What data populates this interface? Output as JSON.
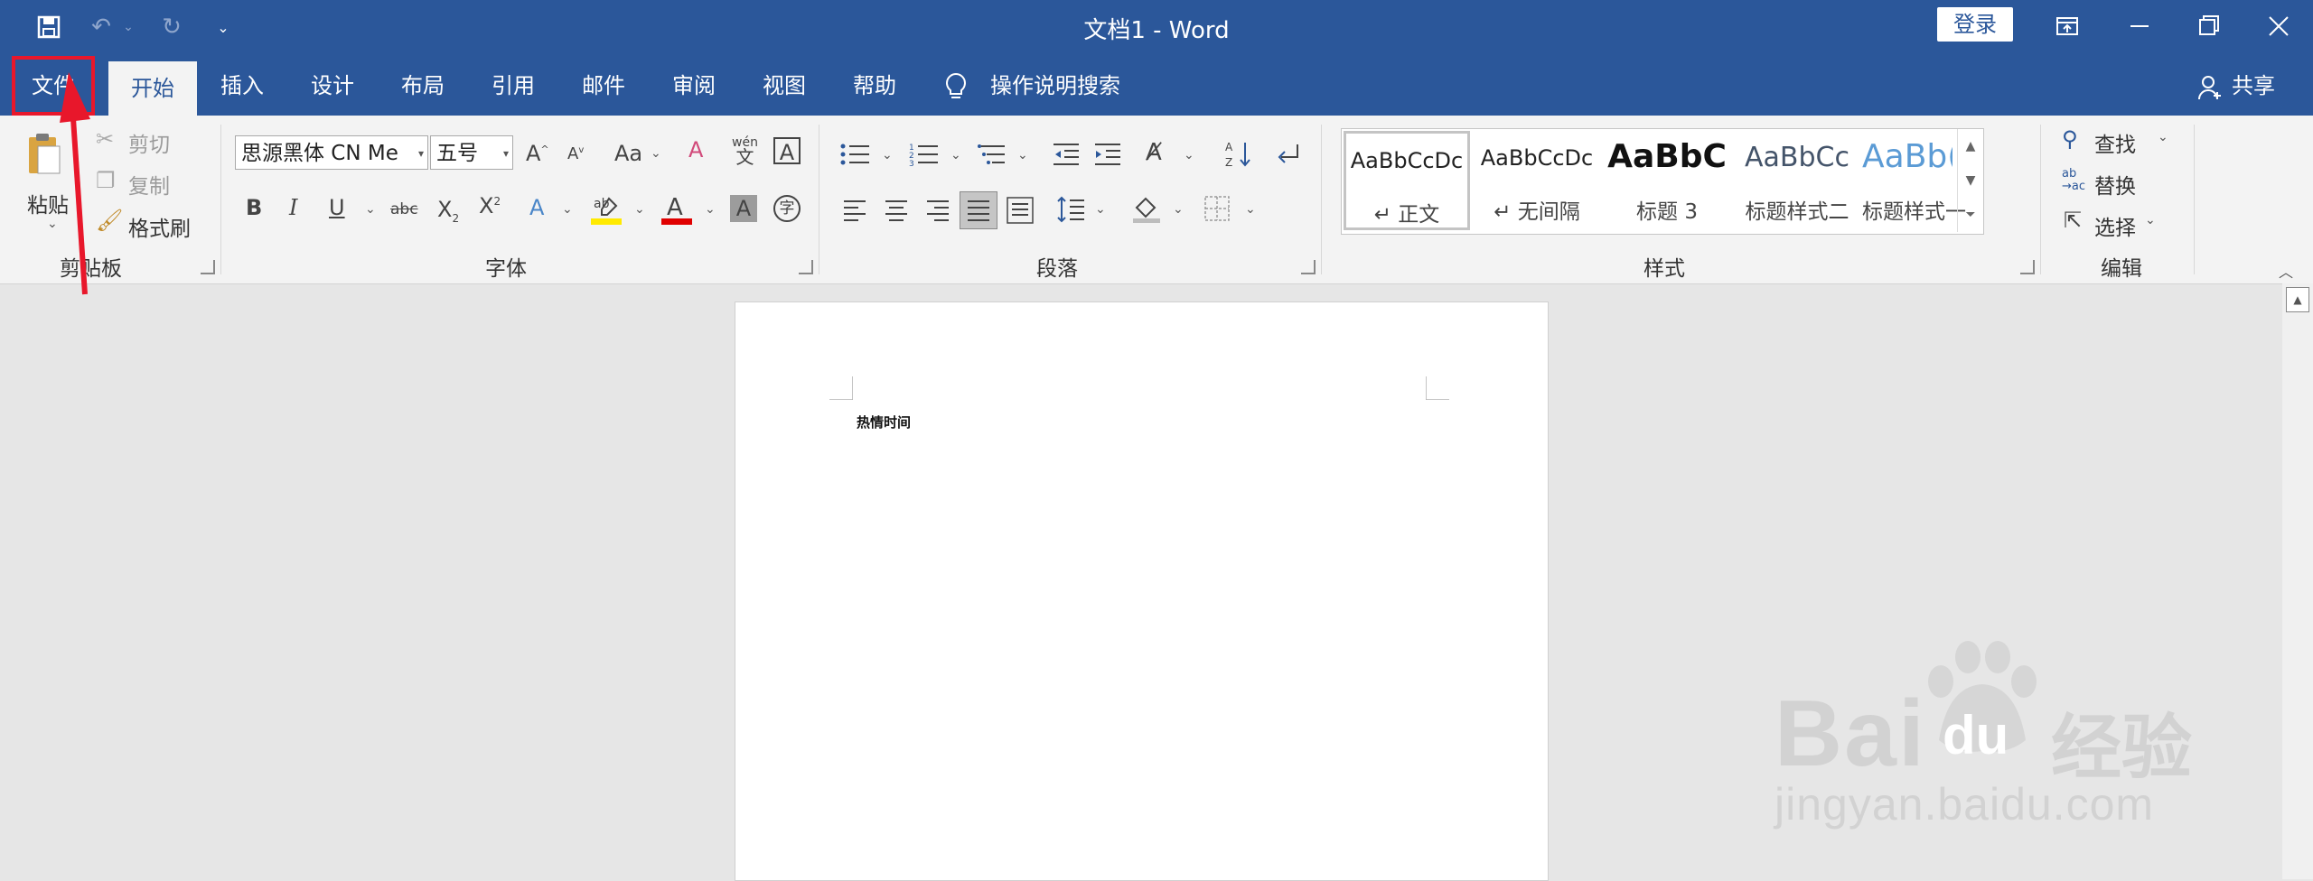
{
  "window": {
    "title": "文档1  -  Word",
    "login_label": "登录"
  },
  "tabs": [
    {
      "label": "文件"
    },
    {
      "label": "开始"
    },
    {
      "label": "插入"
    },
    {
      "label": "设计"
    },
    {
      "label": "布局"
    },
    {
      "label": "引用"
    },
    {
      "label": "邮件"
    },
    {
      "label": "审阅"
    },
    {
      "label": "视图"
    },
    {
      "label": "帮助"
    }
  ],
  "tell_me": "操作说明搜索",
  "share_label": "共享",
  "clipboard": {
    "paste": "粘贴",
    "cut": "剪切",
    "copy": "复制",
    "format_painter": "格式刷",
    "group": "剪贴板"
  },
  "font": {
    "name": "思源黑体 CN Me",
    "size": "五号",
    "case_btn": "Aa",
    "phonetic_top": "wén",
    "phonetic_bottom": "文",
    "group": "字体"
  },
  "paragraph": {
    "group": "段落"
  },
  "styles": {
    "group": "样式",
    "items": [
      {
        "preview": "AaBbCcDc",
        "name": "↵ 正文"
      },
      {
        "preview": "AaBbCcDc",
        "name": "↵ 无间隔"
      },
      {
        "preview": "AaBbC",
        "name": "标题 3"
      },
      {
        "preview": "AaBbCc",
        "name": "标题样式二"
      },
      {
        "preview": "AaBb(",
        "name": "标题样式一"
      }
    ]
  },
  "editing": {
    "find": "查找",
    "replace": "替换",
    "select": "选择",
    "group": "编辑"
  },
  "document": {
    "text": "热情时间"
  },
  "watermark": {
    "brand": "Bai",
    "brand2": "du",
    "product": "经验",
    "url": "jingyan.baidu.com"
  },
  "colors": {
    "accent": "#2b579a",
    "highlight_red": "#e8172b",
    "highlight_yellow": "#ffea00",
    "font_red": "#e00000"
  }
}
